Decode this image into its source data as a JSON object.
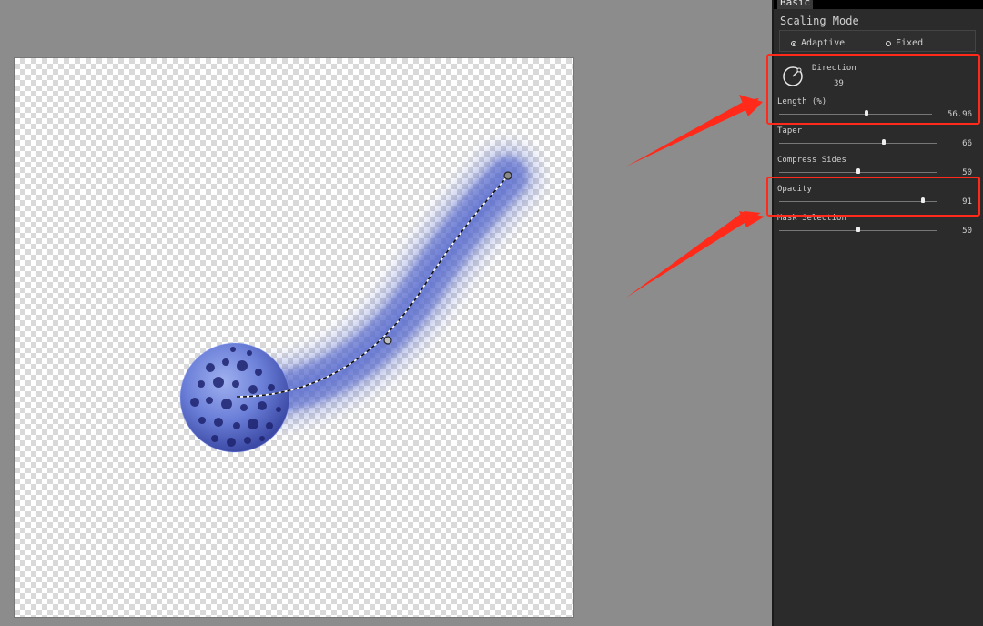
{
  "canvas": {
    "description_free": true
  },
  "panel": {
    "tab_label": "Basic",
    "scaling_mode": {
      "title": "Scaling Mode",
      "options": [
        {
          "label": "Adaptive",
          "selected": true
        },
        {
          "label": "Fixed",
          "selected": false
        }
      ]
    },
    "direction": {
      "label": "Direction",
      "value": "39"
    },
    "length": {
      "label": "Length (%)",
      "value": "56.96",
      "level": 0.5696
    },
    "taper": {
      "label": "Taper",
      "value": "66",
      "level": 0.66
    },
    "compress_sides": {
      "label": "Compress Sides",
      "value": "50",
      "level": 0.5
    },
    "opacity": {
      "label": "Opacity",
      "value": "91",
      "level": 0.91
    },
    "mask_selection": {
      "label": "Mask Selection",
      "value": "50",
      "level": 0.5
    }
  },
  "colors": {
    "highlight": "#ff2a1a",
    "panel_bg": "#2b2b2b",
    "workspace_bg": "#8c8c8c",
    "stroke_blue": "#4b5fc6"
  },
  "icons": [
    "direction-dial-icon",
    "radio-selected-icon",
    "radio-unselected-icon",
    "control-point-icon"
  ]
}
